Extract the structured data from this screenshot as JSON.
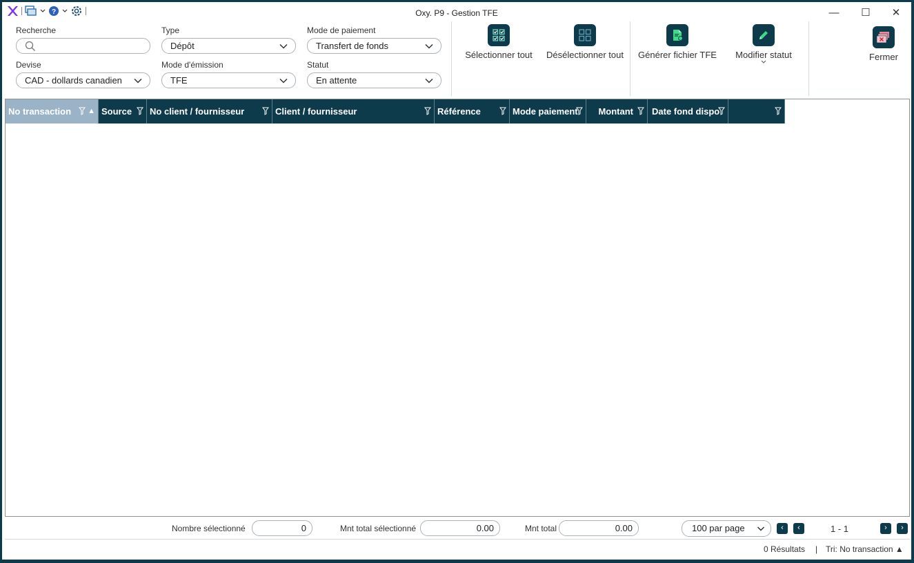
{
  "window": {
    "title": "Oxy. P9 - Gestion TFE",
    "minimize": "—",
    "maximize": "☐",
    "close": "✕"
  },
  "filters": {
    "recherche": {
      "label": "Recherche",
      "value": ""
    },
    "type": {
      "label": "Type",
      "value": "Dépôt"
    },
    "mode_paiement": {
      "label": "Mode de paiement",
      "value": "Transfert de fonds"
    },
    "devise": {
      "label": "Devise",
      "value": "CAD - dollards canadien"
    },
    "mode_emission": {
      "label": "Mode d'émission",
      "value": "TFE"
    },
    "statut": {
      "label": "Statut",
      "value": "En attente"
    }
  },
  "ribbon": {
    "select_all": "Sélectionner tout",
    "deselect_all": "Désélectionner tout",
    "generate": "Générer fichier TFE",
    "modify_status": "Modifier statut",
    "close": "Fermer"
  },
  "grid": {
    "columns": [
      "No transaction",
      "Source",
      "No client / fournisseur",
      "Client / fournisseur",
      "Référence",
      "Mode paiement",
      "Montant",
      "Date fond dispo",
      ""
    ],
    "sort_indicator": "▲",
    "rows": []
  },
  "footer": {
    "nb_selected_label": "Nombre sélectionné",
    "nb_selected_value": "0",
    "mnt_selected_label": "Mnt total sélectionné",
    "mnt_selected_value": "0.00",
    "mnt_total_label": "Mnt total",
    "mnt_total_value": "0.00",
    "per_page": "100 par page",
    "page_range": "1 - 1",
    "results": "0 Résultats",
    "sort_info": "Tri: No transaction ▲"
  },
  "colors": {
    "primary": "#0d3b4c",
    "active_header": "#9ab3c6",
    "logo": "#7b2ff7",
    "green_icon": "#3ddc84"
  }
}
